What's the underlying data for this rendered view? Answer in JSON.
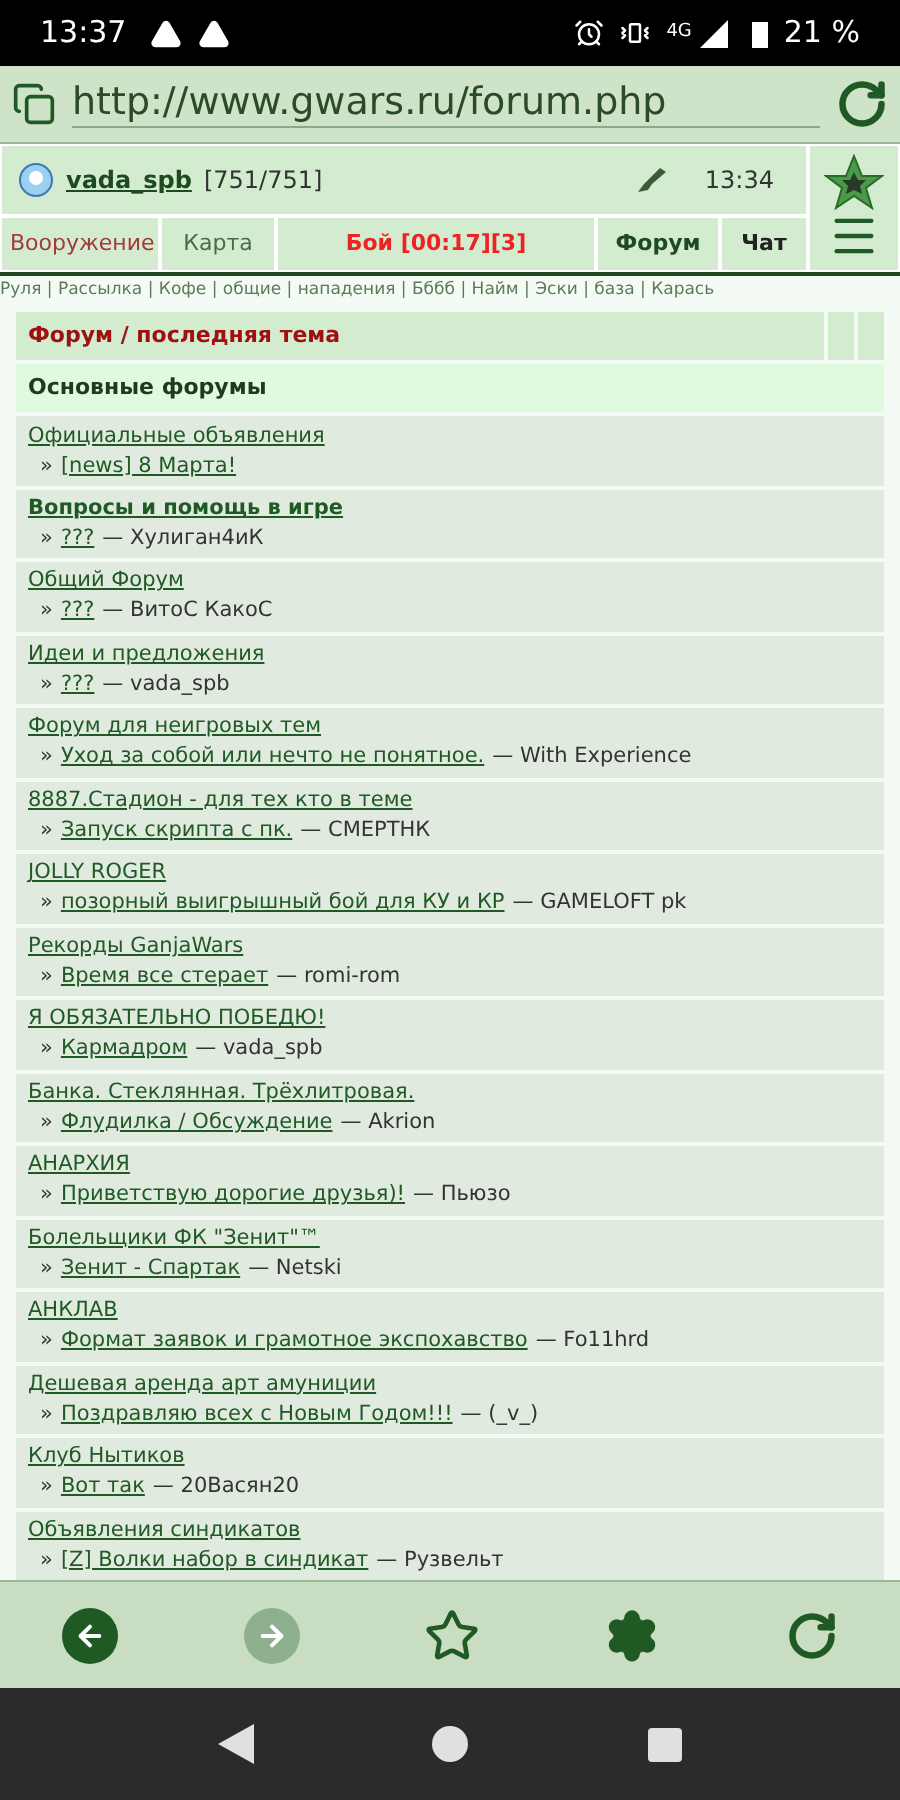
{
  "status_bar": {
    "time": "13:37",
    "network": "4G",
    "battery": "21 %"
  },
  "browser": {
    "url": "http://www.gwars.ru/forum.php"
  },
  "player": {
    "name": "vada_spb",
    "hp": "[751/751]",
    "time": "13:34"
  },
  "tabs": [
    {
      "label": "Вооружение",
      "color": "#a33a3a",
      "bold": false
    },
    {
      "label": "Карта",
      "color": "#4a6a4a",
      "bold": false
    },
    {
      "label": "Бой [00:17][3]",
      "color": "#ee2222",
      "bold": true
    },
    {
      "label": "Форум",
      "color": "#1f4a1f",
      "bold": true
    },
    {
      "label": "Чат",
      "color": "#222222",
      "bold": true
    }
  ],
  "quick_links": "Руля | Рассылка | Кофе | общие | нападения | Бббб | Найм | Эски | база | Карась",
  "table": {
    "header": "Форум / последняя тема",
    "section": "Основные форумы",
    "rows": [
      {
        "title": "Официальные объявления",
        "bold": false,
        "marker": "»",
        "topic": "[news] 8 Марта!"
      },
      {
        "title": "Вопросы и помощь в игре",
        "bold": true,
        "marker": "»",
        "topic": "???",
        "author": "— Хулиган4иК"
      },
      {
        "title": "Общий Форум",
        "bold": false,
        "marker": "»",
        "topic": "???",
        "author": "— ВитоС КакоС"
      },
      {
        "title": "Идеи и предложения",
        "bold": false,
        "marker": "»",
        "topic": "???",
        "author": "— vada_spb"
      },
      {
        "title": "Форум для неигровых тем",
        "bold": false,
        "marker": "»",
        "topic": "Уход за собой или нечто не понятное.",
        "author": "— With Experience"
      },
      {
        "title": "8887.Стадион - для тех кто в теме",
        "bold": false,
        "marker": "»",
        "topic": "Запуск скрипта с пк.",
        "author": "— СМЕРТНК"
      },
      {
        "title": "JOLLY ROGER",
        "bold": false,
        "marker": "»",
        "topic": "позорный выигрышный бой для КУ и КР",
        "author": "— GAMELOFT pk"
      },
      {
        "title": "Рекорды GanjaWars",
        "bold": false,
        "marker": "»",
        "topic": "Время все стерает",
        "author": "— romi-rom"
      },
      {
        "title": "Я ОБЯЗАТЕЛЬНО ПОБЕДЮ!",
        "bold": false,
        "marker": "»",
        "topic": "Кармадром",
        "author": "— vada_spb"
      },
      {
        "title": "Банка. Стеклянная. Трёхлитровая.",
        "bold": false,
        "marker": "»",
        "topic": "Флудилка / Обсуждение",
        "author": "— Akrion"
      },
      {
        "title": "АНАРХИЯ",
        "bold": false,
        "marker": "»",
        "topic": "Приветствую дорогие друзья)!",
        "author": "— Пьюзо"
      },
      {
        "title": "Болельщики ФК \"Зенит\"™",
        "bold": false,
        "marker": "»",
        "topic": "Зенит - Спартак",
        "author": "— Netski"
      },
      {
        "title": "АНКЛАВ",
        "bold": false,
        "marker": "»",
        "topic": "Формат заявок и грамотное экспохавство",
        "author": "— Fo11hrd"
      },
      {
        "title": "Дешевая аренда арт амуниции",
        "bold": false,
        "marker": "»",
        "topic": "Поздравляю всех с Новым Годом!!!",
        "author": "— (_v_)"
      },
      {
        "title": "Клуб Нытиков",
        "bold": false,
        "marker": "»",
        "topic": "Вот так",
        "author": "— 20Васян20"
      },
      {
        "title": "Объявления синдикатов",
        "bold": false,
        "marker": "»",
        "topic": "[Z] Волки набор в синдикат",
        "author": "— Рузвельт"
      }
    ]
  },
  "toolbar": [
    {
      "kind": "back",
      "disabled": false
    },
    {
      "kind": "forward",
      "disabled": true
    },
    {
      "kind": "star",
      "disabled": false
    },
    {
      "kind": "gear",
      "disabled": false
    },
    {
      "kind": "refresh",
      "disabled": false
    }
  ]
}
